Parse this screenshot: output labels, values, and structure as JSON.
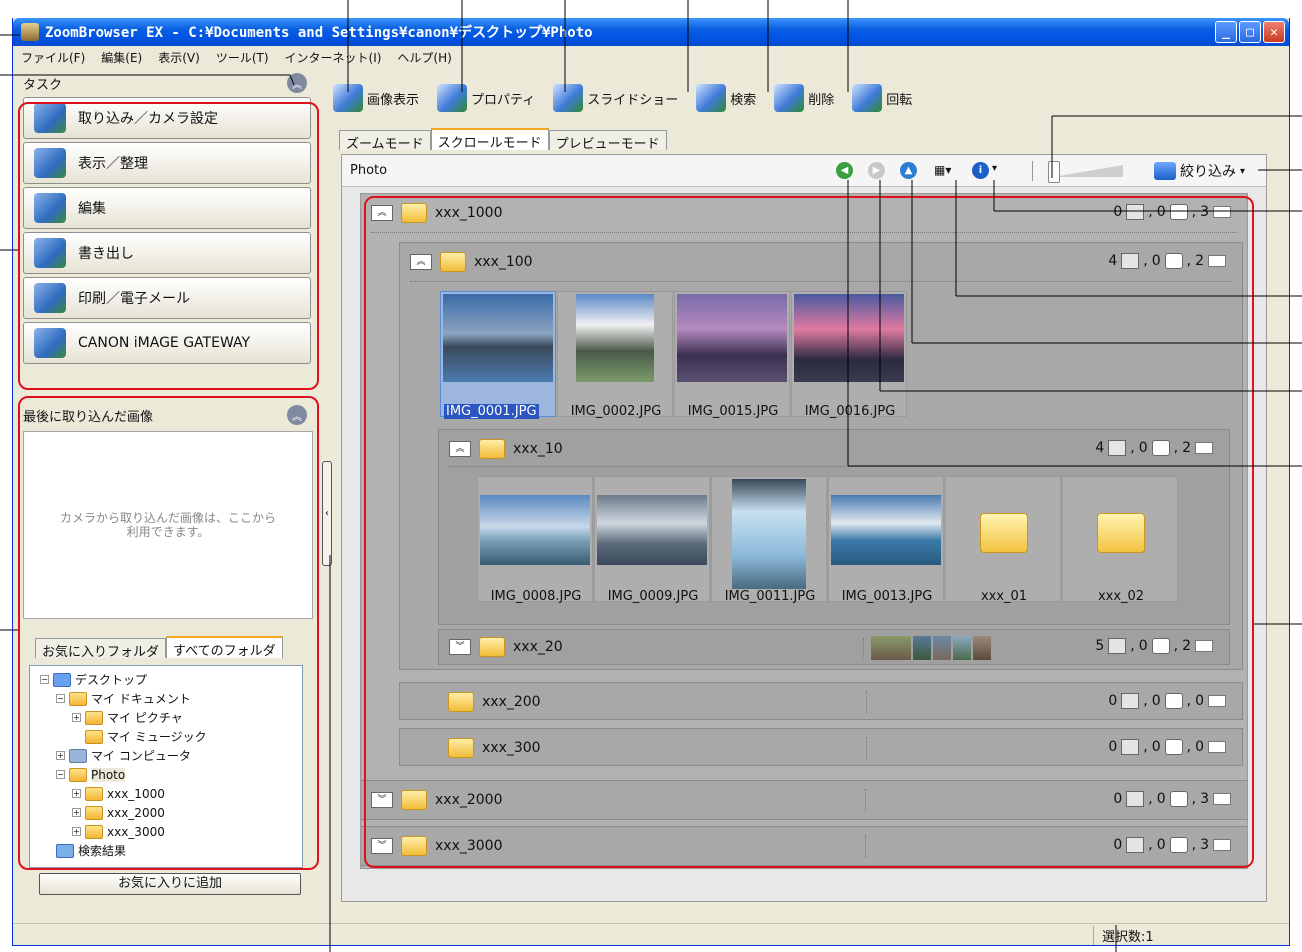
{
  "window": {
    "title": "ZoomBrowser EX  -  C:¥Documents and Settings¥canon¥デスクトップ¥Photo",
    "controls": [
      "_",
      "□",
      "✕"
    ]
  },
  "menu": [
    "ファイル(F)",
    "編集(E)",
    "表示(V)",
    "ツール(T)",
    "インターネット(I)",
    "ヘルプ(H)"
  ],
  "task": {
    "header": "タスク",
    "buttons": [
      "取り込み／カメラ設定",
      "表示／整理",
      "編集",
      "書き出し",
      "印刷／電子メール",
      "CANON iMAGE GATEWAY"
    ]
  },
  "recent": {
    "header": "最後に取り込んだ画像",
    "message_line1": "カメラから取り込んだ画像は、ここから",
    "message_line2": "利用できます。"
  },
  "folder_tabs": [
    "お気に入りフォルダ",
    "すべてのフォルダ"
  ],
  "tree": [
    "デスクトップ",
    "マイ ドキュメント",
    "マイ ピクチャ",
    "マイ ミュージック",
    "マイ コンピュータ",
    "Photo",
    "xxx_1000",
    "xxx_2000",
    "xxx_3000",
    "検索結果"
  ],
  "add_favorite": "お気に入りに追加",
  "toolbar": [
    "画像表示",
    "プロパティ",
    "スライドショー",
    "検索",
    "削除",
    "回転"
  ],
  "mode_tabs": [
    "ズームモード",
    "スクロールモード",
    "プレビューモード"
  ],
  "view": {
    "path": "Photo",
    "filter_label": "絞り込み",
    "zoom_level": 0.1
  },
  "groups": {
    "g1000": {
      "name": "xxx_1000",
      "img": "0",
      "snd": "0",
      "fold": "3"
    },
    "g100": {
      "name": "xxx_100",
      "img": "4",
      "snd": "0",
      "fold": "2"
    },
    "g10": {
      "name": "xxx_10",
      "img": "4",
      "snd": "0",
      "fold": "2"
    },
    "g20": {
      "name": "xxx_20",
      "img": "5",
      "snd": "0",
      "fold": "2"
    },
    "g200": {
      "name": "xxx_200",
      "img": "0",
      "snd": "0",
      "fold": "0"
    },
    "g300": {
      "name": "xxx_300",
      "img": "0",
      "snd": "0",
      "fold": "0"
    },
    "g2000": {
      "name": "xxx_2000",
      "img": "0",
      "snd": "0",
      "fold": "3"
    },
    "g3000": {
      "name": "xxx_3000",
      "img": "0",
      "snd": "0",
      "fold": "3"
    }
  },
  "thumbs100": [
    "IMG_0001.JPG",
    "IMG_0002.JPG",
    "IMG_0015.JPG",
    "IMG_0016.JPG"
  ],
  "thumbs10": [
    "IMG_0008.JPG",
    "IMG_0009.JPG",
    "IMG_0011.JPG",
    "IMG_0013.JPG",
    "xxx_01",
    "xxx_02"
  ],
  "status": {
    "selected": "選択数:1"
  },
  "colors": {
    "annotation_red": "#e0101c",
    "titlebar_blue": "#0054e3",
    "selection_blue": "#2b55c0"
  }
}
